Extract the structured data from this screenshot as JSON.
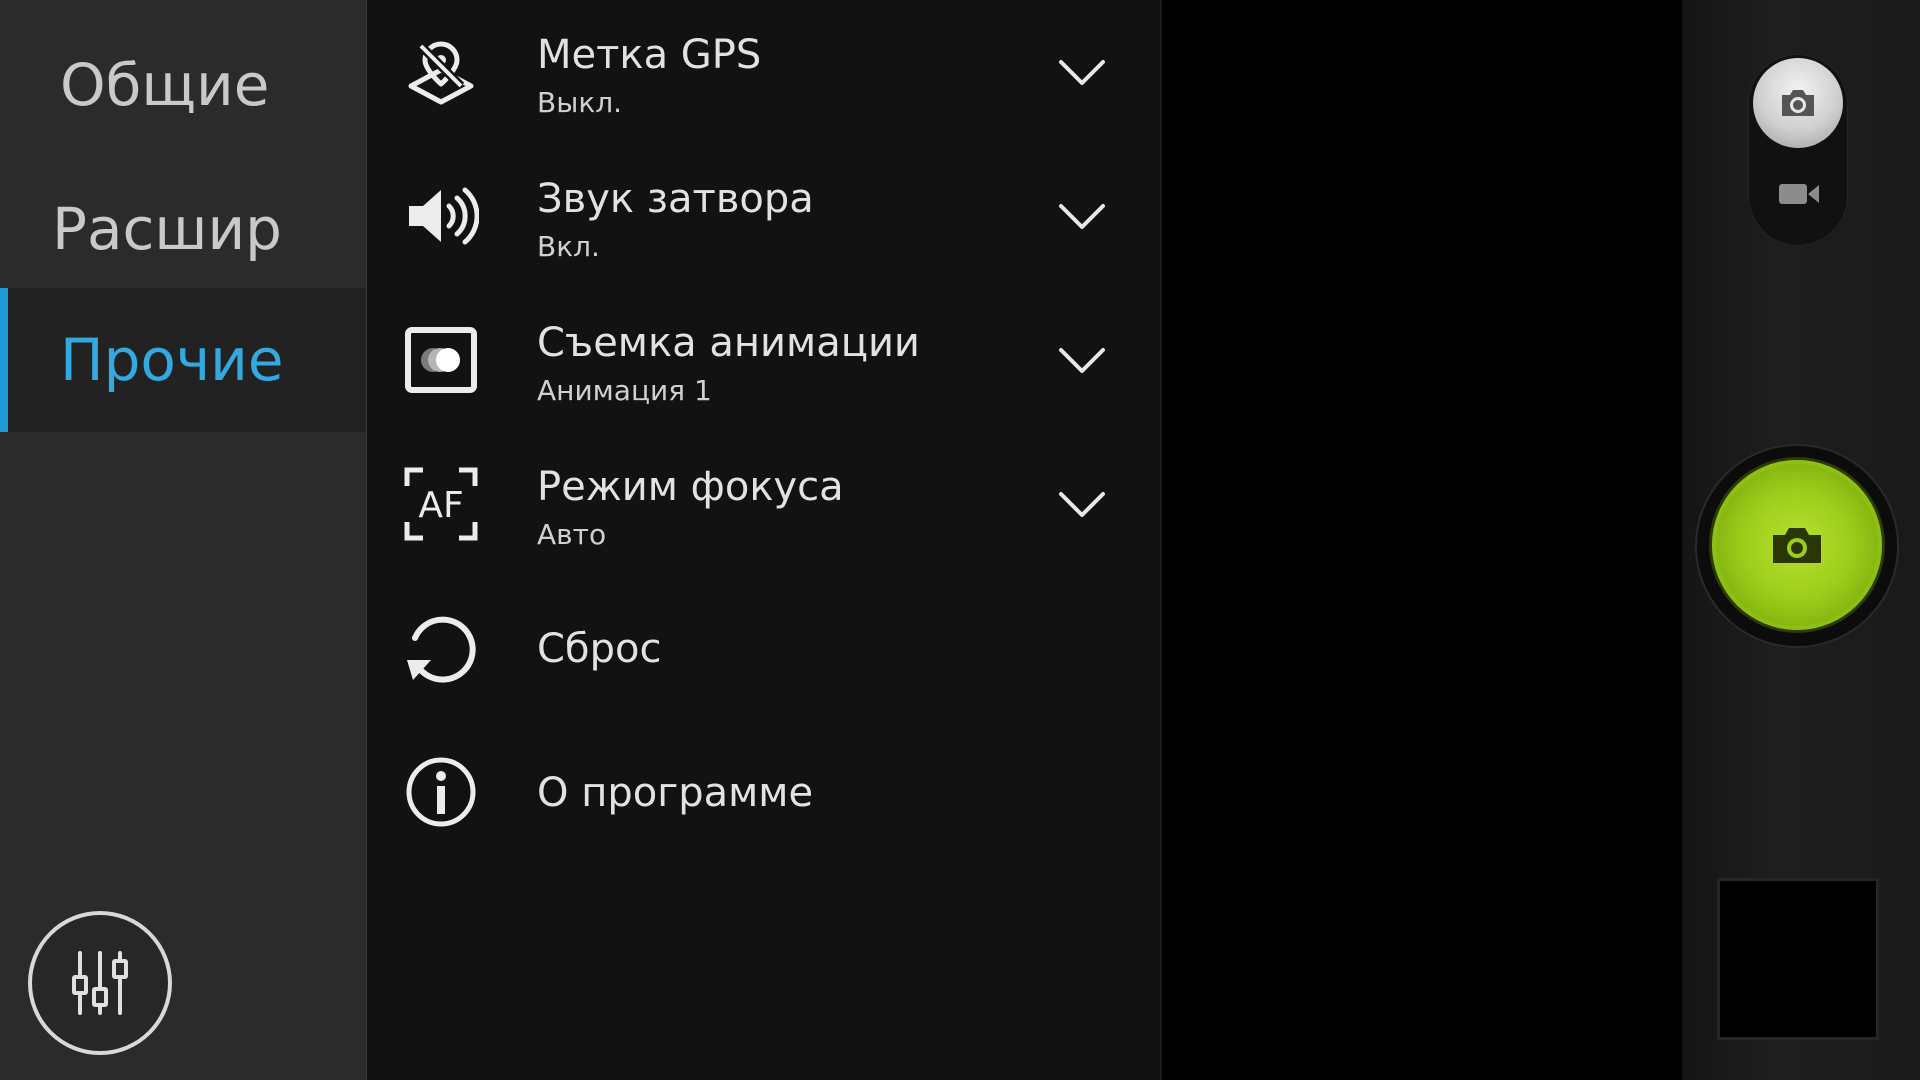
{
  "tabs": [
    {
      "label": "Общие",
      "active": false
    },
    {
      "label": "Расшир",
      "active": false
    },
    {
      "label": "Прочие",
      "active": true
    }
  ],
  "settings": [
    {
      "icon": "gps-tag-icon",
      "title": "Метка GPS",
      "value": "Выкл.",
      "has_dropdown": true
    },
    {
      "icon": "speaker-icon",
      "title": "Звук затвора",
      "value": "Вкл.",
      "has_dropdown": true
    },
    {
      "icon": "animation-icon",
      "title": "Съемка анимации",
      "value": "Анимация 1",
      "has_dropdown": true
    },
    {
      "icon": "af-focus-icon",
      "title": "Режим фокуса",
      "value": "Авто",
      "has_dropdown": true
    },
    {
      "icon": "reset-icon",
      "title": "Сброс",
      "value": "",
      "has_dropdown": false
    },
    {
      "icon": "info-icon",
      "title": "О программе",
      "value": "",
      "has_dropdown": false
    }
  ],
  "colors": {
    "accent": "#1e9ad6",
    "active_tab_text": "#33a9e0",
    "shutter": "#9ccd1a",
    "tab_bg": "#2b2b2b",
    "list_bg": "#121212"
  },
  "controls": {
    "mode": "photo",
    "icons": [
      "camera-mode-icon",
      "video-mode-icon",
      "shutter-camera-icon",
      "settings-sliders-icon"
    ]
  }
}
